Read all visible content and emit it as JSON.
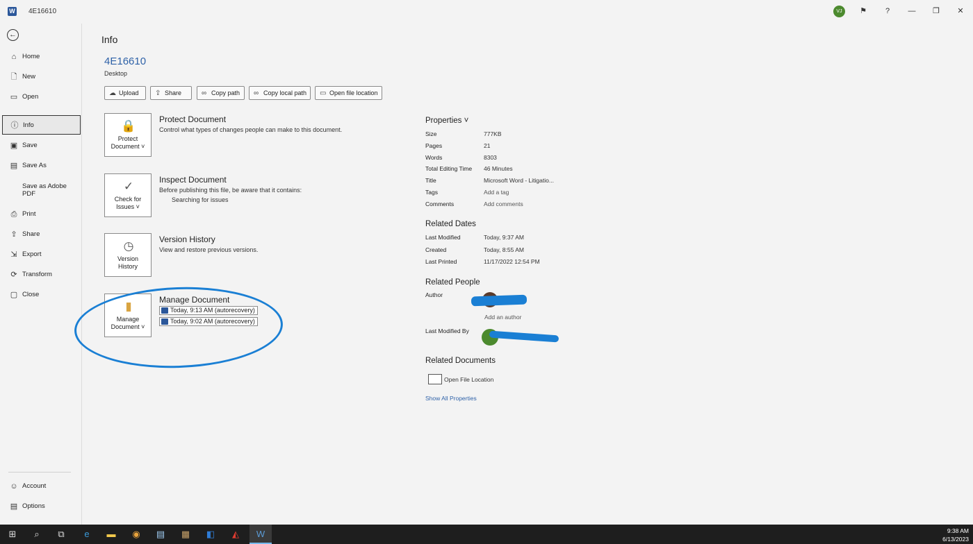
{
  "titlebar": {
    "doc_title": "4E16610",
    "avatar_initials": "VJ",
    "help": "?",
    "minimize": "—",
    "restore": "❐",
    "close": "✕",
    "feedback": "⚑"
  },
  "sidebar": {
    "items": [
      {
        "label": "Home",
        "icon": "home-icon"
      },
      {
        "label": "New",
        "icon": "new-document-icon"
      },
      {
        "label": "Open",
        "icon": "folder-open-icon"
      },
      {
        "label": "Info",
        "icon": "info-icon"
      },
      {
        "label": "Save",
        "icon": "save-icon"
      },
      {
        "label": "Save As",
        "icon": "save-as-icon"
      },
      {
        "label": "Save as Adobe PDF",
        "icon": ""
      },
      {
        "label": "Print",
        "icon": "print-icon"
      },
      {
        "label": "Share",
        "icon": "share-icon"
      },
      {
        "label": "Export",
        "icon": "export-icon"
      },
      {
        "label": "Transform",
        "icon": "transform-icon"
      },
      {
        "label": "Close",
        "icon": "close-folder-icon"
      }
    ],
    "bottom": [
      {
        "label": "Account",
        "icon": "account-icon"
      },
      {
        "label": "Options",
        "icon": "options-icon"
      }
    ]
  },
  "main": {
    "heading": "Info",
    "doc_name": "4E16610",
    "doc_location": "Desktop",
    "actions": [
      "Upload",
      "Share",
      "Copy path",
      "Copy local path",
      "Open file location"
    ],
    "sections": {
      "protect": {
        "tile": "Protect Document ˅",
        "title": "Protect Document",
        "desc": "Control what types of changes people can make to this document."
      },
      "inspect": {
        "tile": "Check for Issues ˅",
        "title": "Inspect Document",
        "desc": "Before publishing this file, be aware that it contains:",
        "sub": "Searching for issues"
      },
      "version": {
        "tile": "Version History",
        "title": "Version History",
        "desc": "View and restore previous versions."
      },
      "manage": {
        "tile": "Manage Document ˅",
        "title": "Manage Document",
        "autorecovery": [
          "Today, 9:13 AM (autorecovery)",
          "Today, 9:02 AM (autorecovery)"
        ]
      }
    }
  },
  "properties": {
    "heading": "Properties ˅",
    "rows": [
      {
        "k": "Size",
        "v": "777KB"
      },
      {
        "k": "Pages",
        "v": "21"
      },
      {
        "k": "Words",
        "v": "8303"
      },
      {
        "k": "Total Editing Time",
        "v": "46 Minutes"
      },
      {
        "k": "Title",
        "v": "Microsoft Word - Litigatio..."
      },
      {
        "k": "Tags",
        "v": "Add a tag"
      },
      {
        "k": "Comments",
        "v": "Add comments"
      }
    ],
    "dates_heading": "Related Dates",
    "dates": [
      {
        "k": "Last Modified",
        "v": "Today, 9:37 AM"
      },
      {
        "k": "Created",
        "v": "Today, 8:55 AM"
      },
      {
        "k": "Last Printed",
        "v": "11/17/2022 12:54 PM"
      }
    ],
    "people_heading": "Related People",
    "author_label": "Author",
    "add_author": "Add an author",
    "last_modified_by_label": "Last Modified By",
    "docs_heading": "Related Documents",
    "open_file_location": "Open File Location",
    "show_all": "Show All Properties"
  },
  "taskbar": {
    "time": "9:38 AM",
    "date": "6/13/2023"
  },
  "colors": {
    "accent": "#2f62a8",
    "annotation": "#1a7fd4",
    "word_blue": "#2b579a"
  }
}
